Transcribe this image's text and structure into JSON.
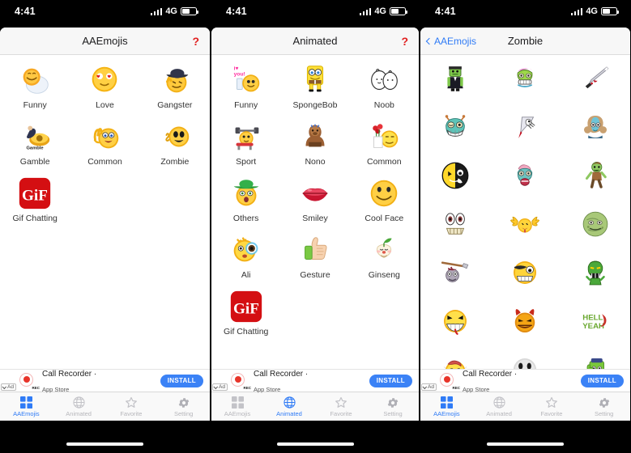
{
  "status_bar": {
    "time": "4:41",
    "network": "4G",
    "battery_level": 55
  },
  "ad": {
    "label": "Ad",
    "title": "Call Recorder ·",
    "subtitle": "App Store",
    "install_label": "INSTALL",
    "rec_label": "REC",
    "accent": "#3b82f6"
  },
  "tabs": [
    {
      "label": "AAEmojis",
      "icon": "grid-icon"
    },
    {
      "label": "Animated",
      "icon": "globe-icon"
    },
    {
      "label": "Favorite",
      "icon": "star-icon"
    },
    {
      "label": "Setting",
      "icon": "gear-icon"
    }
  ],
  "colors": {
    "accent": "#2f7bf6",
    "help": "#e02020",
    "inactive": "#b6b6bb"
  },
  "screens": [
    {
      "nav": {
        "title": "AAEmojis",
        "help": "?",
        "back": null
      },
      "active_tab": 0,
      "items": [
        {
          "label": "Funny",
          "icon": "funny-emoji"
        },
        {
          "label": "Love",
          "icon": "love-emoji"
        },
        {
          "label": "Gangster",
          "icon": "gangster-emoji"
        },
        {
          "label": "Gamble",
          "icon": "gamble-emoji"
        },
        {
          "label": "Common",
          "icon": "common-emoji"
        },
        {
          "label": "Zombie",
          "icon": "zombie-emoji"
        },
        {
          "label": "Gif Chatting",
          "icon": "gif-icon"
        }
      ]
    },
    {
      "nav": {
        "title": "Animated",
        "help": "?",
        "back": null
      },
      "active_tab": 1,
      "items": [
        {
          "label": "Funny",
          "icon": "iloveyou-emoji"
        },
        {
          "label": "SpongeBob",
          "icon": "spongebob-icon"
        },
        {
          "label": "Noob",
          "icon": "noob-icon"
        },
        {
          "label": "Sport",
          "icon": "sport-emoji"
        },
        {
          "label": "Nono",
          "icon": "nono-icon"
        },
        {
          "label": "Common",
          "icon": "roses-emoji"
        },
        {
          "label": "Others",
          "icon": "hat-emoji"
        },
        {
          "label": "Smiley",
          "icon": "lips-icon"
        },
        {
          "label": "Cool Face",
          "icon": "coolface-emoji"
        },
        {
          "label": "Ali",
          "icon": "ali-emoji"
        },
        {
          "label": "Gesture",
          "icon": "thumbsup-icon"
        },
        {
          "label": "Ginseng",
          "icon": "ginseng-icon"
        },
        {
          "label": "Gif Chatting",
          "icon": "gif-icon"
        }
      ]
    },
    {
      "nav": {
        "title": "Zombie",
        "help": null,
        "back": "AAEmojis"
      },
      "active_tab": 0,
      "items": [
        {
          "label": "",
          "icon": "frankenstein-sticker"
        },
        {
          "label": "",
          "icon": "zombie-head-pink-sticker"
        },
        {
          "label": "",
          "icon": "bloody-knife-sticker"
        },
        {
          "label": "",
          "icon": "teal-zombie-head-sticker"
        },
        {
          "label": "",
          "icon": "hand-knife-sticker"
        },
        {
          "label": "",
          "icon": "zombie-girl-sticker"
        },
        {
          "label": "",
          "icon": "half-face-sticker"
        },
        {
          "label": "",
          "icon": "brain-zombie-sticker"
        },
        {
          "label": "",
          "icon": "walking-zombie-sticker"
        },
        {
          "label": "",
          "icon": "eyes-teeth-sticker"
        },
        {
          "label": "",
          "icon": "rock-hands-emoji"
        },
        {
          "label": "",
          "icon": "green-zombie-ball-sticker"
        },
        {
          "label": "",
          "icon": "axe-head-sticker"
        },
        {
          "label": "",
          "icon": "eyepatch-emoji"
        },
        {
          "label": "",
          "icon": "green-zombie-sticker"
        },
        {
          "label": "",
          "icon": "evil-grin-emoji"
        },
        {
          "label": "",
          "icon": "devil-emoji"
        },
        {
          "label": "",
          "icon": "hell-yeah-text-sticker"
        },
        {
          "label": "",
          "icon": "brain-emoji"
        },
        {
          "label": "",
          "icon": "ghost-face-emoji"
        },
        {
          "label": "",
          "icon": "green-thumbs-up-sticker"
        }
      ]
    }
  ]
}
